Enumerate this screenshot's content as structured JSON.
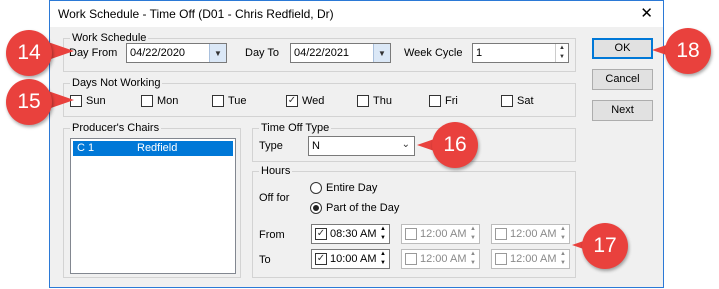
{
  "window": {
    "title": "Work Schedule - Time Off (D01 - Chris Redfield, Dr)",
    "close_glyph": "✕"
  },
  "work_schedule": {
    "group_label": "Work Schedule",
    "day_from_label": "Day From",
    "day_from_value": "04/22/2020",
    "day_to_label": "Day To",
    "day_to_value": "04/22/2021",
    "week_cycle_label": "Week Cycle",
    "week_cycle_value": "1"
  },
  "days_not_working": {
    "group_label": "Days Not Working",
    "days": [
      {
        "label": "Sun",
        "checked": false
      },
      {
        "label": "Mon",
        "checked": false
      },
      {
        "label": "Tue",
        "checked": false
      },
      {
        "label": "Wed",
        "checked": true
      },
      {
        "label": "Thu",
        "checked": false
      },
      {
        "label": "Fri",
        "checked": false
      },
      {
        "label": "Sat",
        "checked": false
      }
    ]
  },
  "producers_chairs": {
    "group_label": "Producer's Chairs",
    "row_code": "C 1",
    "row_name": "Redfield"
  },
  "time_off_type": {
    "group_label": "Time Off Type",
    "type_label": "Type",
    "type_value": "N"
  },
  "hours": {
    "group_label": "Hours",
    "off_for_label": "Off for",
    "entire_day_label": "Entire Day",
    "part_of_day_label": "Part of the Day",
    "from_label": "From",
    "to_label": "To",
    "from_times": [
      "08:30 AM",
      "12:00 AM",
      "12:00 AM"
    ],
    "to_times": [
      "10:00 AM",
      "12:00 AM",
      "12:00 AM"
    ]
  },
  "buttons": {
    "ok": "OK",
    "cancel": "Cancel",
    "next": "Next"
  },
  "callouts": [
    "14",
    "15",
    "16",
    "17",
    "18"
  ],
  "colors": {
    "callout": "#e9413d",
    "selection": "#0078d7",
    "default_button_border": "#0078d7"
  }
}
